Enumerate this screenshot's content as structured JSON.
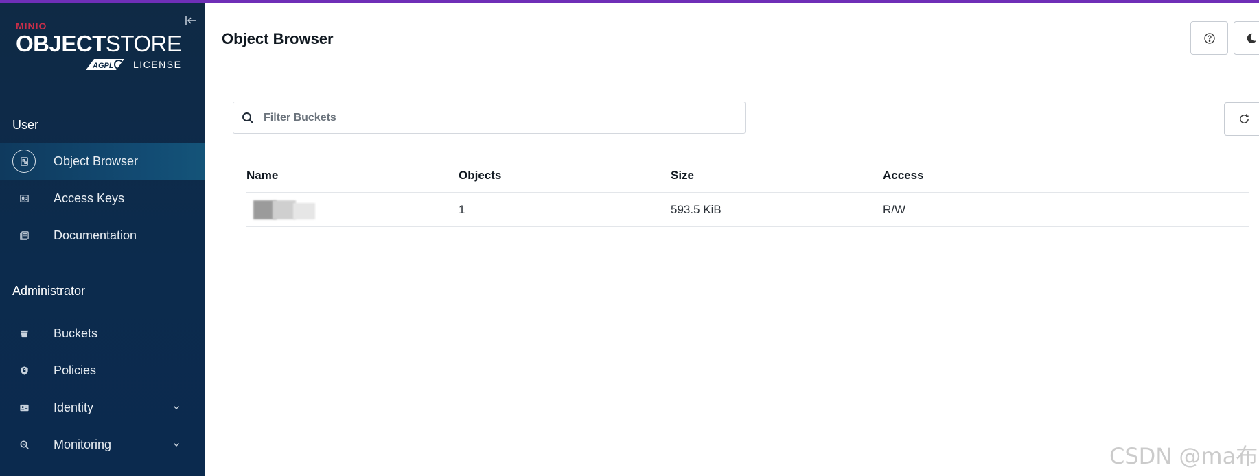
{
  "brand": {
    "vendor": "MINIO",
    "product_bold": "OBJECT",
    "product_light": "STORE",
    "license_badge": "AGPL",
    "license_label": "LICENSE",
    "accent_color": "#6f2fb7",
    "vendor_color": "#c72e49"
  },
  "sidebar": {
    "user_section": "User",
    "user_items": [
      {
        "label": "Object Browser",
        "icon": "object-browser-icon",
        "active": true
      },
      {
        "label": "Access Keys",
        "icon": "access-keys-icon"
      },
      {
        "label": "Documentation",
        "icon": "documentation-icon"
      }
    ],
    "admin_section": "Administrator",
    "admin_items": [
      {
        "label": "Buckets",
        "icon": "bucket-icon"
      },
      {
        "label": "Policies",
        "icon": "policies-icon"
      },
      {
        "label": "Identity",
        "icon": "identity-icon",
        "expandable": true
      },
      {
        "label": "Monitoring",
        "icon": "monitoring-icon",
        "expandable": true
      }
    ]
  },
  "header": {
    "title": "Object Browser"
  },
  "search": {
    "placeholder": "Filter Buckets",
    "value": ""
  },
  "table": {
    "columns": [
      "Name",
      "Objects",
      "Size",
      "Access"
    ],
    "rows": [
      {
        "name": "",
        "objects": "1",
        "size": "593.5 KiB",
        "access": "R/W"
      }
    ]
  },
  "watermark": "CSDN @ma布"
}
